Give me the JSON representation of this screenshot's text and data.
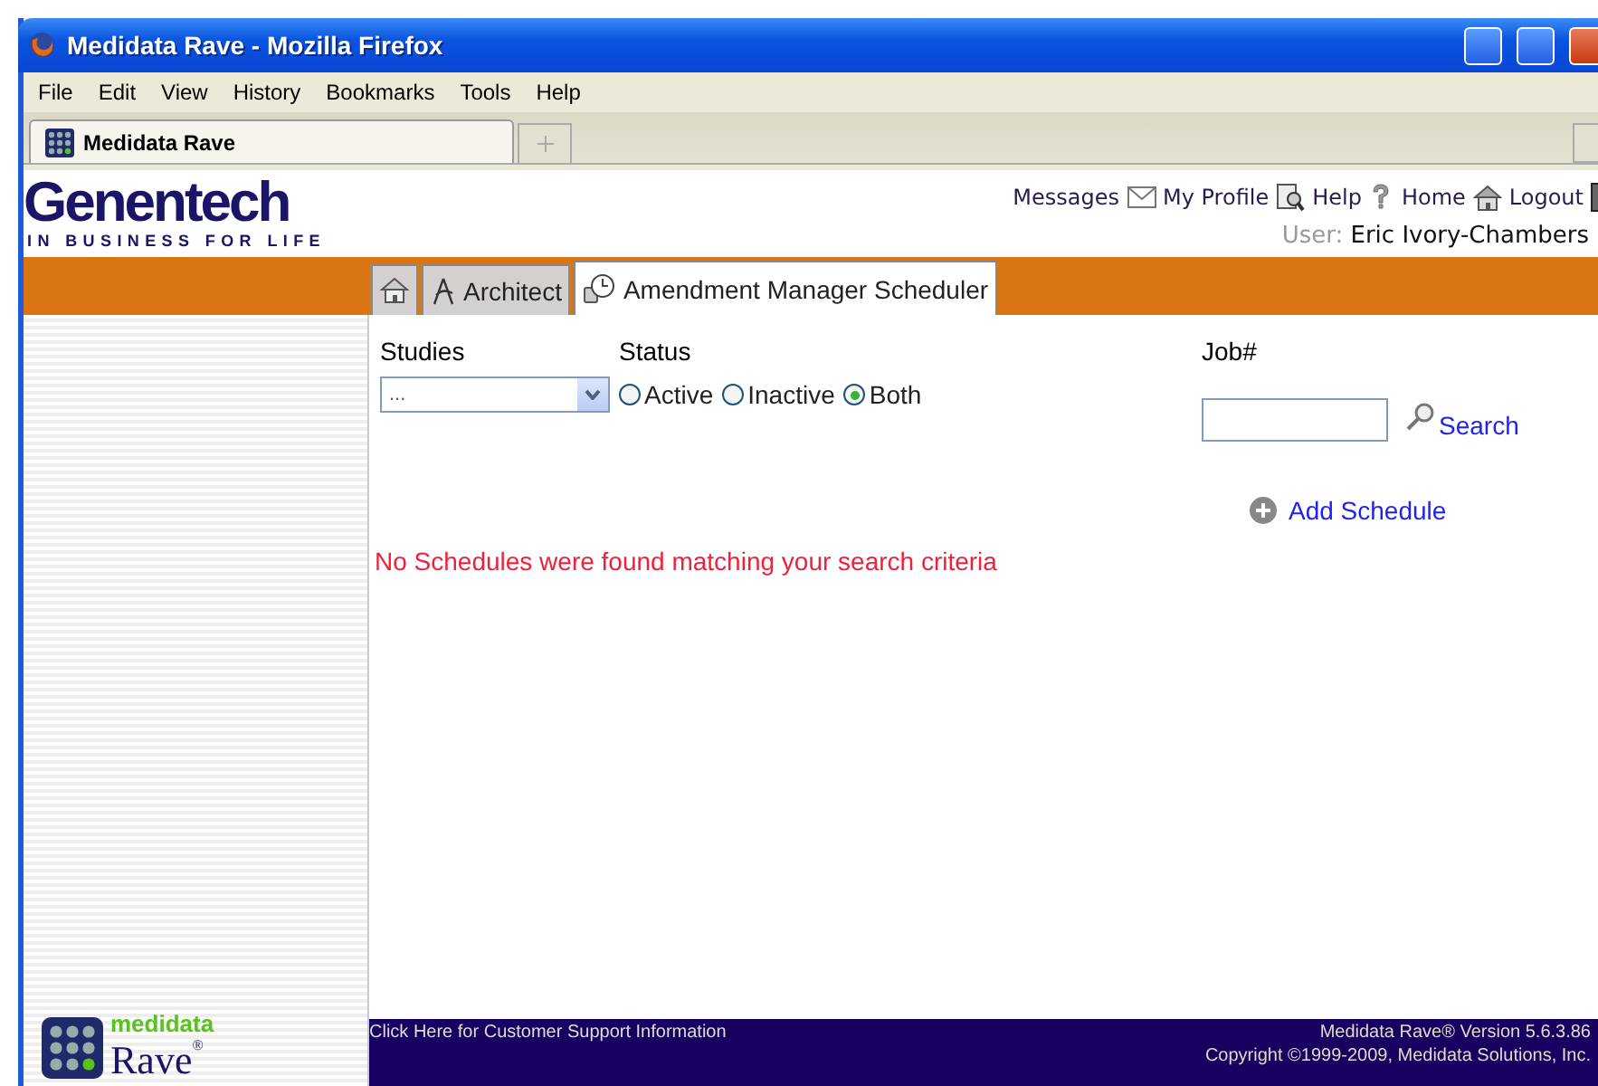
{
  "window": {
    "title": "Medidata Rave - Mozilla Firefox"
  },
  "menu": [
    "File",
    "Edit",
    "View",
    "History",
    "Bookmarks",
    "Tools",
    "Help"
  ],
  "browser_tabs": [
    {
      "label": "Medidata Rave",
      "selected": true
    }
  ],
  "header": {
    "logo": "Genentech",
    "tagline": "IN BUSINESS FOR LIFE",
    "links": [
      {
        "label": "Messages",
        "kind": "mail"
      },
      {
        "label": "My Profile",
        "kind": "profile"
      },
      {
        "label": "Help",
        "kind": "help"
      },
      {
        "label": "Home",
        "kind": "home"
      },
      {
        "label": "Logout",
        "kind": "logout"
      }
    ],
    "user_label": "User:",
    "user_name": "Eric Ivory-Chambers"
  },
  "tabs": [
    {
      "kind": "home",
      "selected": false
    },
    {
      "kind": "architect",
      "label": "Architect",
      "selected": false
    },
    {
      "kind": "scheduler",
      "label": "Amendment Manager Scheduler",
      "selected": true
    }
  ],
  "filters": {
    "studies_label": "Studies",
    "studies_value": "...",
    "status_label": "Status",
    "status": [
      {
        "label": "Active",
        "selected": false
      },
      {
        "label": "Inactive",
        "selected": false
      },
      {
        "label": "Both",
        "selected": true
      }
    ],
    "job_label": "Job#",
    "search": "Search",
    "add": "Add Schedule"
  },
  "message": "No Schedules were found matching your search criteria",
  "sidebar_logo": {
    "top": "medidata",
    "bottom": "Rave",
    "mark": "®"
  },
  "footer": {
    "support": "Click Here for Customer Support Information",
    "version": "Medidata Rave® Version 5.6.3.86",
    "copyright": "Copyright ©1999-2009, Medidata Solutions, Inc."
  }
}
